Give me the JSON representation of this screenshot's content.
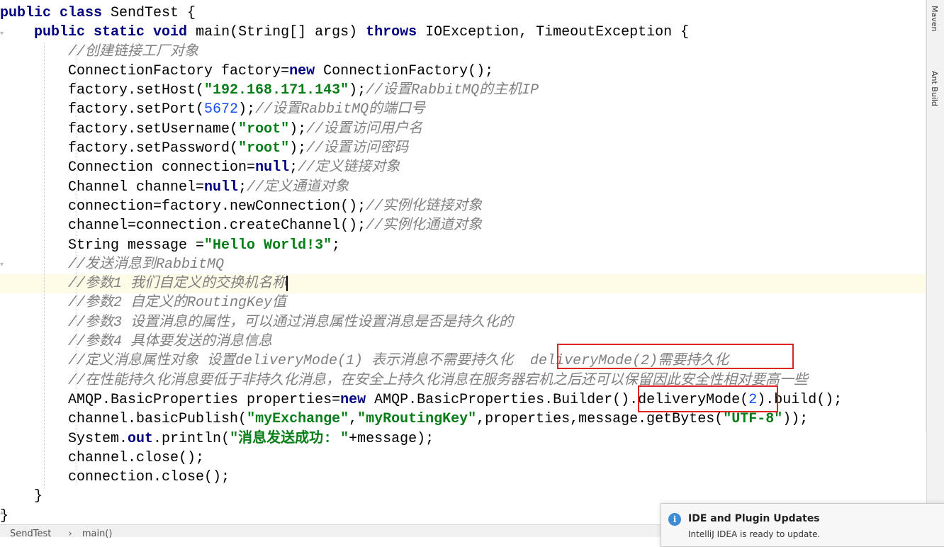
{
  "code_lines": [
    [
      {
        "t": "public class ",
        "c": "kw"
      },
      {
        "t": "SendTest {",
        "c": ""
      }
    ],
    [
      {
        "t": "    ",
        "c": ""
      },
      {
        "t": "public static void ",
        "c": "kw"
      },
      {
        "t": "main(String[] args) ",
        "c": ""
      },
      {
        "t": "throws ",
        "c": "kw"
      },
      {
        "t": "IOException, TimeoutException {",
        "c": ""
      }
    ],
    [
      {
        "t": "        ",
        "c": ""
      },
      {
        "t": "//创建链接工厂对象",
        "c": "cmt"
      }
    ],
    [
      {
        "t": "        ConnectionFactory factory=",
        "c": ""
      },
      {
        "t": "new ",
        "c": "kw"
      },
      {
        "t": "ConnectionFactory();",
        "c": ""
      }
    ],
    [
      {
        "t": "        factory.setHost(",
        "c": ""
      },
      {
        "t": "\"192.168.171.143\"",
        "c": "str"
      },
      {
        "t": ");",
        "c": ""
      },
      {
        "t": "//设置RabbitMQ的主机IP",
        "c": "cmt"
      }
    ],
    [
      {
        "t": "        factory.setPort(",
        "c": ""
      },
      {
        "t": "5672",
        "c": "num"
      },
      {
        "t": ");",
        "c": ""
      },
      {
        "t": "//设置RabbitMQ的端口号",
        "c": "cmt"
      }
    ],
    [
      {
        "t": "        factory.setUsername(",
        "c": ""
      },
      {
        "t": "\"root\"",
        "c": "str"
      },
      {
        "t": ");",
        "c": ""
      },
      {
        "t": "//设置访问用户名",
        "c": "cmt"
      }
    ],
    [
      {
        "t": "        factory.setPassword(",
        "c": ""
      },
      {
        "t": "\"root\"",
        "c": "str"
      },
      {
        "t": ");",
        "c": ""
      },
      {
        "t": "//设置访问密码",
        "c": "cmt"
      }
    ],
    [
      {
        "t": "        Connection connection=",
        "c": ""
      },
      {
        "t": "null",
        "c": "kw"
      },
      {
        "t": ";",
        "c": ""
      },
      {
        "t": "//定义链接对象",
        "c": "cmt"
      }
    ],
    [
      {
        "t": "        Channel channel=",
        "c": ""
      },
      {
        "t": "null",
        "c": "kw"
      },
      {
        "t": ";",
        "c": ""
      },
      {
        "t": "//定义通道对象",
        "c": "cmt"
      }
    ],
    [
      {
        "t": "        connection=factory.newConnection();",
        "c": ""
      },
      {
        "t": "//实例化链接对象",
        "c": "cmt"
      }
    ],
    [
      {
        "t": "        channel=connection.createChannel();",
        "c": ""
      },
      {
        "t": "//实例化通道对象",
        "c": "cmt"
      }
    ],
    [
      {
        "t": "        String message =",
        "c": ""
      },
      {
        "t": "\"Hello World!3\"",
        "c": "str"
      },
      {
        "t": ";",
        "c": ""
      }
    ],
    [
      {
        "t": "        ",
        "c": ""
      },
      {
        "t": "//发送消息到RabbitMQ",
        "c": "cmt"
      }
    ],
    [
      {
        "t": "        ",
        "c": ""
      },
      {
        "t": "//参数1 我们自定义的交换机名称",
        "c": "cmt"
      },
      {
        "t": "",
        "c": "caret"
      }
    ],
    [
      {
        "t": "        ",
        "c": ""
      },
      {
        "t": "//参数2 自定义的RoutingKey值",
        "c": "cmt"
      }
    ],
    [
      {
        "t": "        ",
        "c": ""
      },
      {
        "t": "//参数3 设置消息的属性，可以通过消息属性设置消息是否是持久化的",
        "c": "cmt"
      }
    ],
    [
      {
        "t": "        ",
        "c": ""
      },
      {
        "t": "//参数4 具体要发送的消息信息",
        "c": "cmt"
      }
    ],
    [
      {
        "t": "        ",
        "c": ""
      },
      {
        "t": "//定义消息属性对象 设置deliveryMode(1) 表示消息不需要持久化  deliveryMode(2)需要持久化",
        "c": "cmt"
      }
    ],
    [
      {
        "t": "        ",
        "c": ""
      },
      {
        "t": "//在性能持久化消息要低于非持久化消息，在安全上持久化消息在服务器宕机之后还可以保留因此安全性相对要高一些",
        "c": "cmt"
      }
    ],
    [
      {
        "t": "        AMQP.BasicProperties properties=",
        "c": ""
      },
      {
        "t": "new ",
        "c": "kw"
      },
      {
        "t": "AMQP.BasicProperties.Builder().deliveryMode(",
        "c": ""
      },
      {
        "t": "2",
        "c": "num"
      },
      {
        "t": ").build();",
        "c": ""
      }
    ],
    [
      {
        "t": "        channel.basicPublish(",
        "c": ""
      },
      {
        "t": "\"myExchange\"",
        "c": "str"
      },
      {
        "t": ",",
        "c": ""
      },
      {
        "t": "\"myRoutingKey\"",
        "c": "str"
      },
      {
        "t": ",properties,message.getBytes(",
        "c": ""
      },
      {
        "t": "\"UTF-8\"",
        "c": "str"
      },
      {
        "t": "));",
        "c": ""
      }
    ],
    [
      {
        "t": "        System.",
        "c": ""
      },
      {
        "t": "out",
        "c": "kw"
      },
      {
        "t": ".println(",
        "c": ""
      },
      {
        "t": "\"消息发送成功: \"",
        "c": "str"
      },
      {
        "t": "+message);",
        "c": ""
      }
    ],
    [
      {
        "t": "        channel.close();",
        "c": ""
      }
    ],
    [
      {
        "t": "        connection.close();",
        "c": ""
      }
    ],
    [
      {
        "t": "    }",
        "c": ""
      }
    ],
    [
      {
        "t": "}",
        "c": ""
      }
    ]
  ],
  "side_tabs": {
    "maven": "Maven",
    "ant": "Ant Build"
  },
  "breadcrumb": {
    "class_name": "SendTest",
    "separator": "›",
    "method_name": "main()"
  },
  "notification": {
    "icon": "info-icon",
    "title": "IDE and Plugin Updates",
    "body": "IntelliJ IDEA is ready to update."
  },
  "colors": {
    "keyword": "#000080",
    "string": "#067d17",
    "number": "#1750eb",
    "comment": "#808080",
    "annotation_box": "#e02424"
  }
}
